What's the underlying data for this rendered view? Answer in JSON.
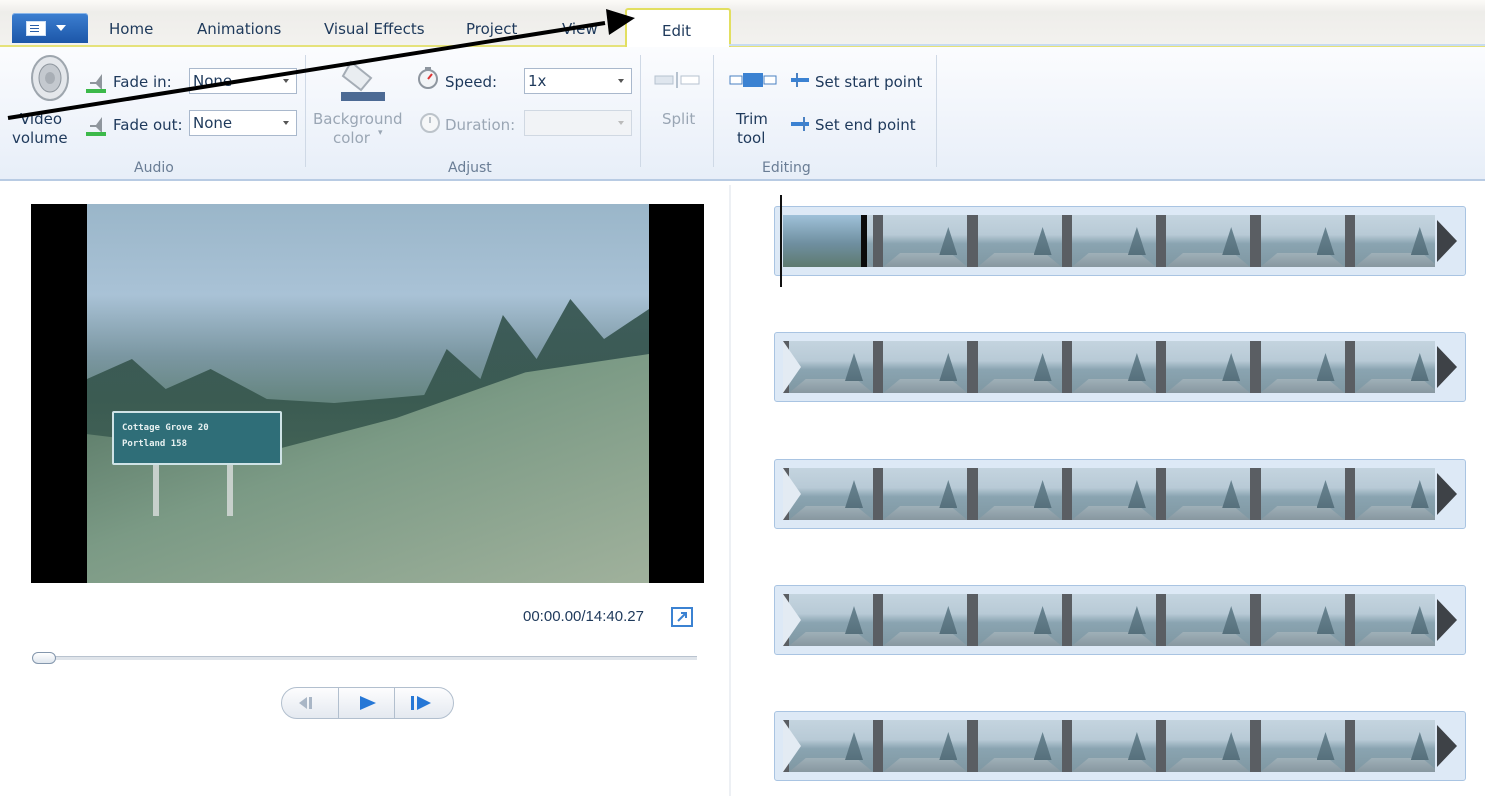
{
  "tabs": {
    "items": [
      {
        "label": "Home"
      },
      {
        "label": "Animations"
      },
      {
        "label": "Visual Effects"
      },
      {
        "label": "Project"
      },
      {
        "label": "View"
      },
      {
        "label": "Edit"
      }
    ],
    "active": "Edit"
  },
  "ribbon": {
    "audio": {
      "group_label": "Audio",
      "video_volume_label_1": "Video",
      "video_volume_label_2": "volume",
      "fade_in_label": "Fade in:",
      "fade_in_value": "None",
      "fade_out_label": "Fade out:",
      "fade_out_value": "None"
    },
    "adjust": {
      "group_label": "Adjust",
      "background_label_1": "Background",
      "background_label_2": "color",
      "speed_label": "Speed:",
      "speed_value": "1x",
      "duration_label": "Duration:",
      "duration_value": ""
    },
    "editing": {
      "group_label": "Editing",
      "split_label": "Split",
      "trim_label_1": "Trim",
      "trim_label_2": "tool",
      "set_start_label": "Set start point",
      "set_end_label": "Set end point"
    }
  },
  "preview": {
    "sign_line1": "Cottage Grove  20",
    "sign_line2": "Portland      158",
    "timecode": "00:00.00/14:40.27",
    "seek_position": 0
  },
  "storyboard": {
    "strip_count": 5,
    "thumbs_per_strip": 7
  },
  "colors": {
    "accent": "#1c56a8",
    "active_tab_border": "#e2df60",
    "ribbon_text": "#1e395b",
    "strip_background": "#dde9f6"
  }
}
